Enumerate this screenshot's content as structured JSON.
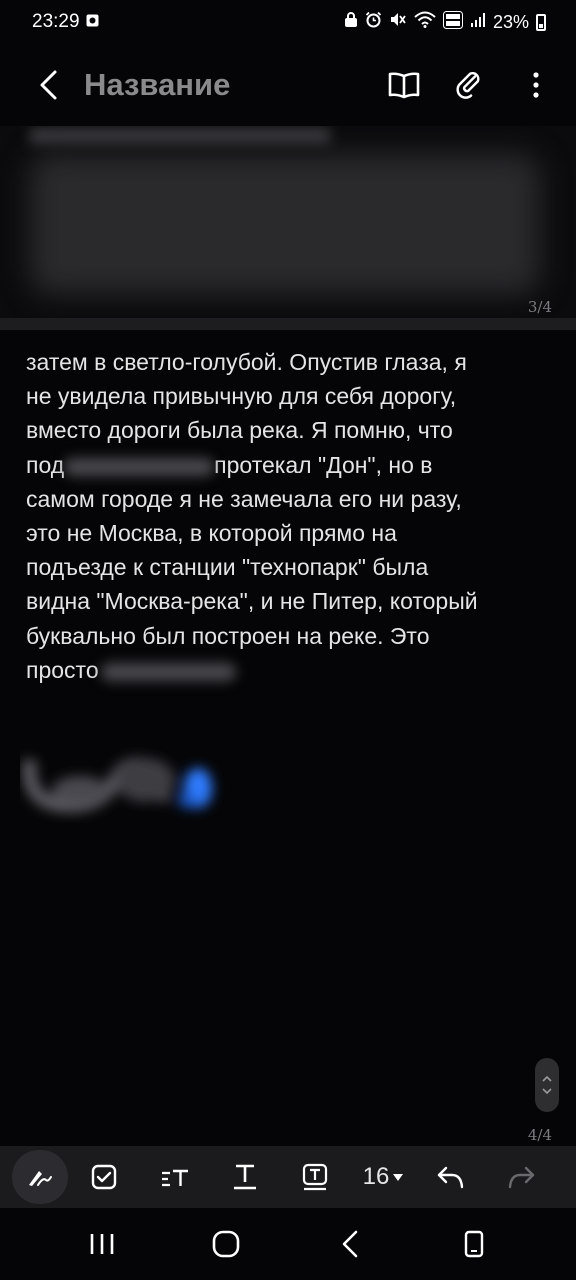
{
  "status_bar": {
    "time": "23:29",
    "battery_percent": "23%"
  },
  "header": {
    "title": "Название"
  },
  "page_indicators": {
    "page3": "3/4",
    "page4": "4/4"
  },
  "note": {
    "lines": [
      "затем в светло-голубой. Опустив глаза, я",
      "не увидела привычную для себя дорогу,",
      "вместо дороги была река. Я помню, что",
      "протекал \"Дон\", но в",
      "самом городе я не замечала его ни разу,",
      "это не Москва, в которой прямо на",
      "подъезде к станции \"технопарк\" была",
      "видна \"Москва-река\", и не Питер, который",
      "буквально был построен на реке. Это"
    ],
    "line4_prefix": "под",
    "line10_prefix": "просто"
  },
  "toolbar": {
    "font_size": "16"
  },
  "colors": {
    "background": "#050507",
    "toolbar": "#1b1b1e",
    "title_gray": "#8a8a8d",
    "scribble_blue": "#2f7bff"
  },
  "icons": {
    "back": "chevron-left-icon",
    "reading_mode": "open-book-icon",
    "attach": "paperclip-icon",
    "more": "more-vertical-icon",
    "pen": "pen-icon",
    "checkbox": "checkbox-icon",
    "text_style": "text-style-icon",
    "text_format": "text-underline-icon",
    "text_box": "text-box-icon",
    "undo": "undo-icon",
    "redo": "redo-icon"
  }
}
